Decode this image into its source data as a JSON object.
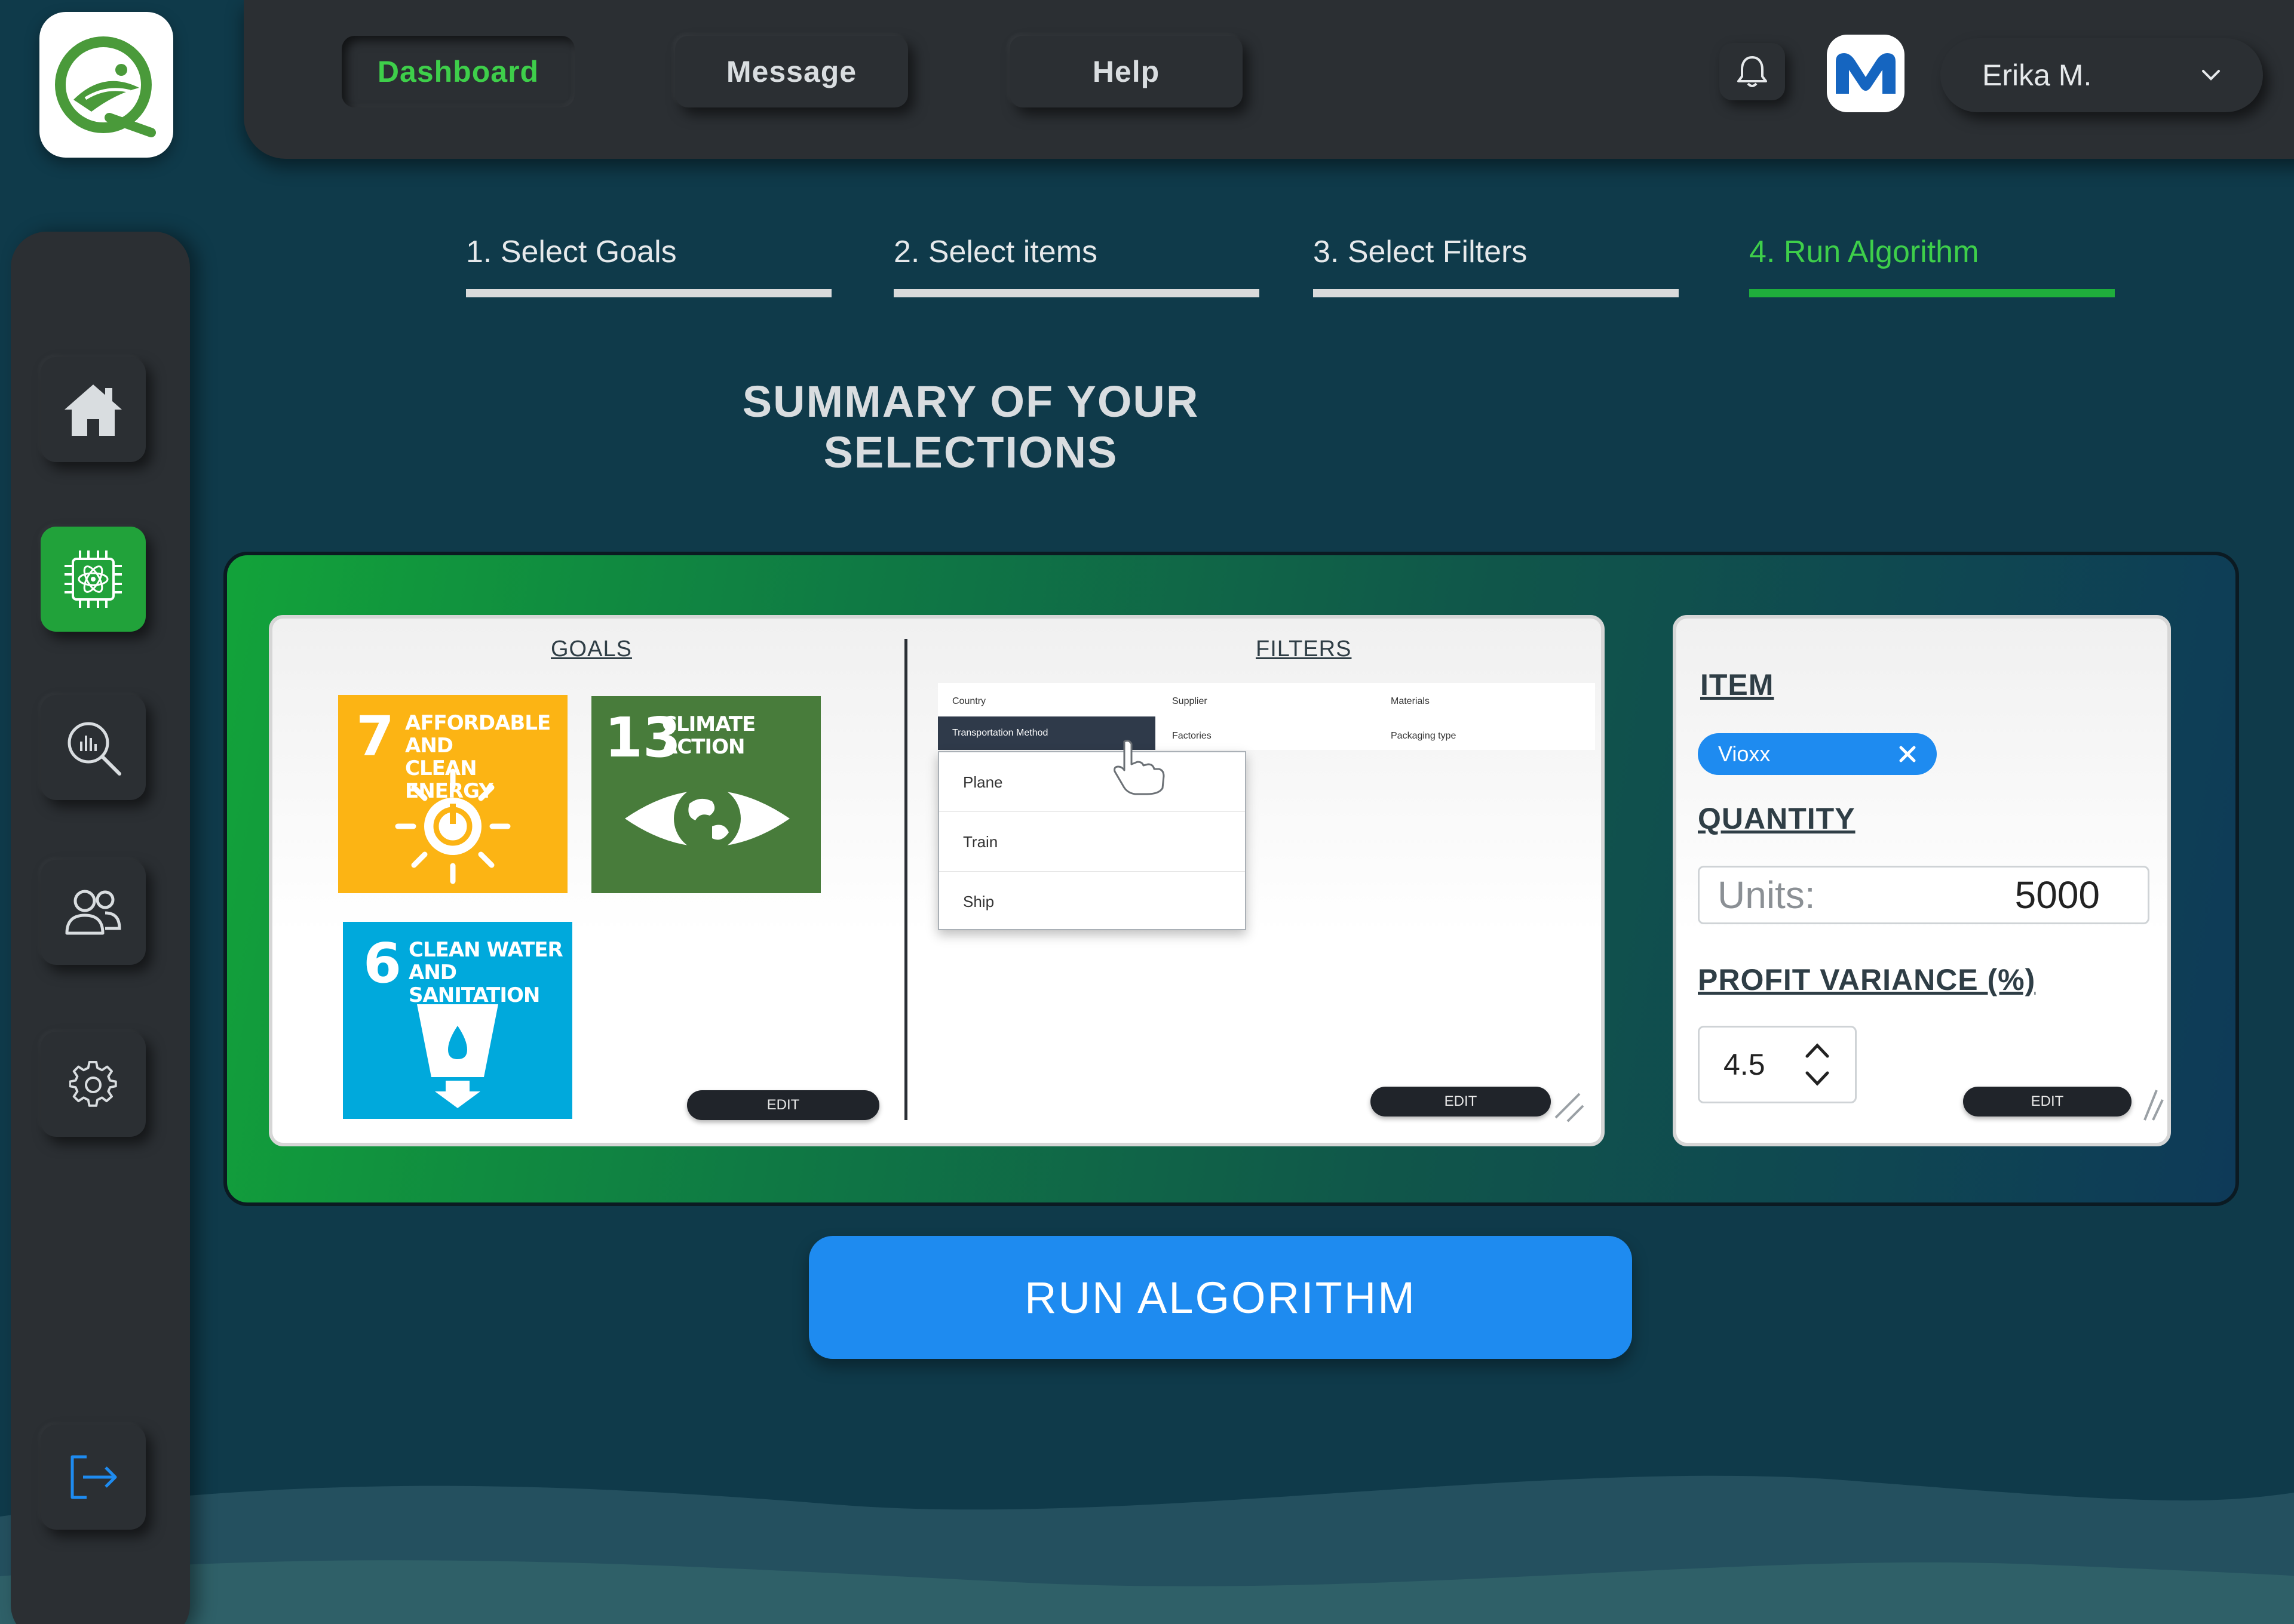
{
  "nav": {
    "dashboard": "Dashboard",
    "message": "Message",
    "help": "Help"
  },
  "user": {
    "name": "Erika M."
  },
  "steps": [
    {
      "label": "1. Select Goals"
    },
    {
      "label": "2. Select items"
    },
    {
      "label": "3. Select Filters"
    },
    {
      "label": "4. Run Algorithm"
    }
  ],
  "summary_title": "SUMMARY OF YOUR SELECTIONS",
  "goals": {
    "title": "GOALS",
    "cards": [
      {
        "num": "7",
        "line1": "AFFORDABLE AND",
        "line2": "CLEAN ENERGY",
        "color": "#fcb414"
      },
      {
        "num": "13",
        "line1": "CLIMATE",
        "line2": "ACTION",
        "color": "#487c3b"
      },
      {
        "num": "6",
        "line1": "CLEAN WATER",
        "line2": "AND SANITATION",
        "color": "#00a9dc"
      }
    ],
    "edit_label": "EDIT"
  },
  "filters": {
    "title": "FILTERS",
    "columns": {
      "country": "Country",
      "supplier": "Supplier",
      "materials": "Materials",
      "transport": "Transportation Method",
      "factories": "Factories",
      "packaging": "Packaging type"
    },
    "options": [
      "Plane",
      "Train",
      "Ship"
    ],
    "edit_label": "EDIT"
  },
  "item_panel": {
    "item_title": "ITEM",
    "item_chip": "Vioxx",
    "quantity_title": "QUANTITY",
    "units_placeholder": "Units:",
    "units_value": "5000",
    "profit_title": "PROFIT VARIANCE (%)",
    "profit_value": "4.5",
    "edit_label": "EDIT"
  },
  "run_button": "RUN ALGORITHM",
  "colors": {
    "accent_green": "#3ecf4a",
    "primary_blue": "#1e8bf0",
    "surface_dark": "#2b2f33"
  }
}
